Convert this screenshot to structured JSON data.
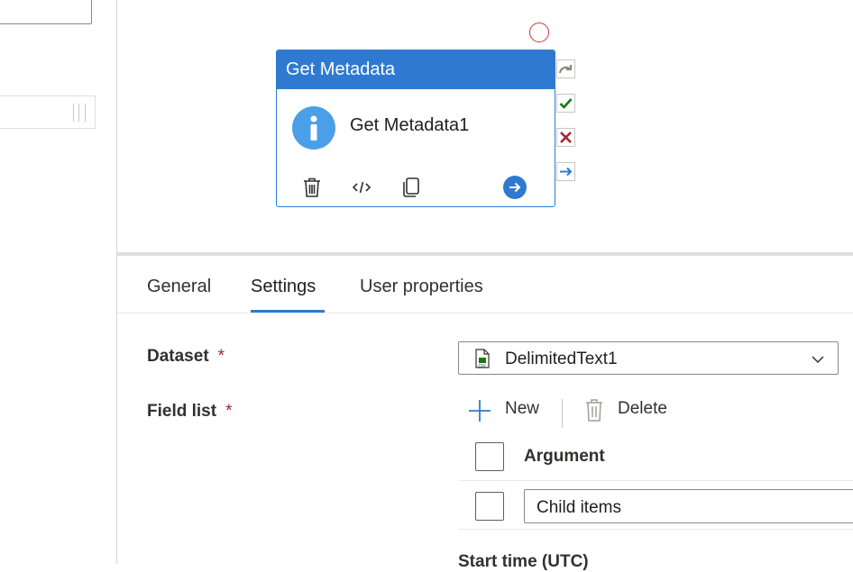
{
  "activity": {
    "type_title": "Get Metadata",
    "name": "Get Metadata1"
  },
  "tabs": {
    "general": "General",
    "settings": "Settings",
    "user_properties": "User properties"
  },
  "form": {
    "dataset_label": "Dataset",
    "field_list_label": "Field list",
    "required_mark": "*",
    "dataset_value": "DelimitedText1",
    "new_label": "New",
    "delete_label": "Delete",
    "argument_header": "Argument",
    "argument_row_value": "Child items",
    "start_time_label": "Start time (UTC)"
  },
  "icons": {
    "activity": "info-icon",
    "delete": "trash-icon",
    "code": "code-icon",
    "copy": "copy-icon",
    "run": "arrow-right-circle-icon",
    "skip": "skip-arrow-icon",
    "success": "check-icon",
    "failure": "x-icon",
    "completion": "arrow-right-icon",
    "dataset_file": "csv-file-icon",
    "chevron": "chevron-down-icon",
    "add": "plus-icon"
  },
  "colors": {
    "accent": "#2f7ad0",
    "success": "#107c10",
    "failure": "#a4262c",
    "error": "#d13438"
  }
}
